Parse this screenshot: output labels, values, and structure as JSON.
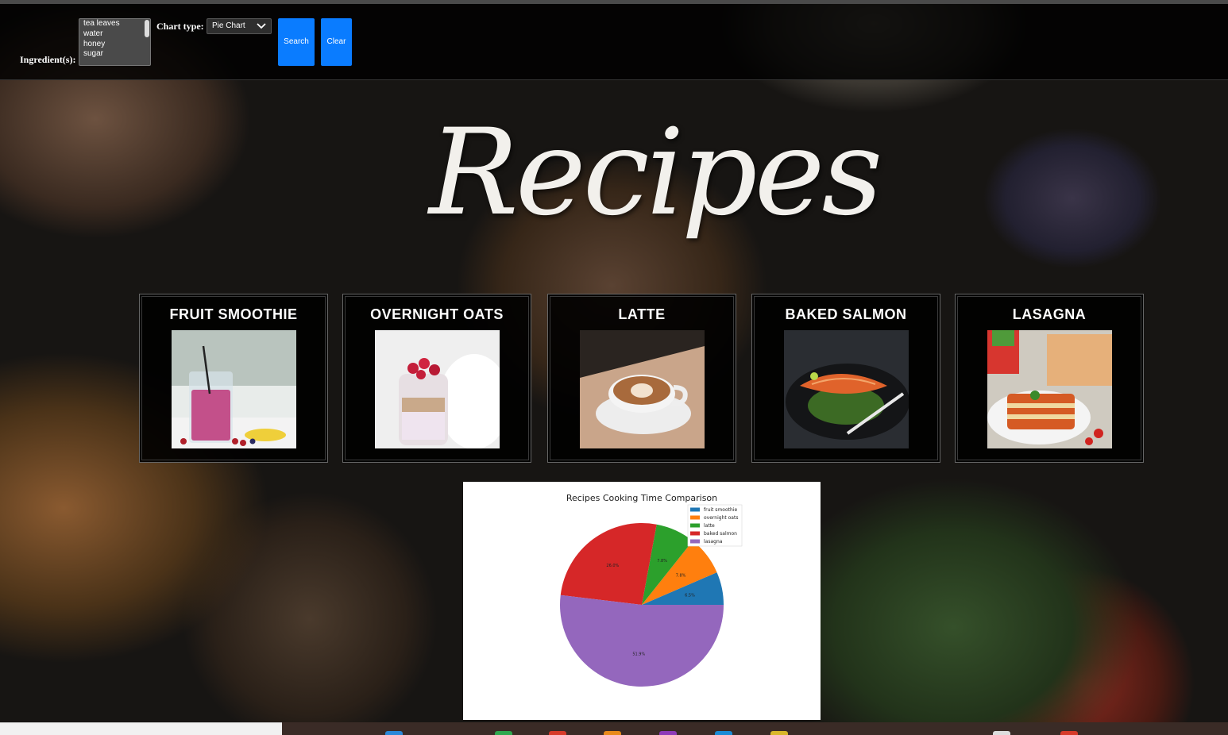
{
  "toolbar": {
    "ingredients_label": "Ingredient(s):",
    "ingredients": [
      "tea leaves",
      "water",
      "honey",
      "sugar"
    ],
    "chart_type_label": "Chart type:",
    "chart_type_value": "Pie Chart",
    "search_label": "Search",
    "clear_label": "Clear"
  },
  "page_title": "Recipes",
  "recipes": [
    {
      "name": "FRUIT SMOOTHIE",
      "image": "smoothie-photo"
    },
    {
      "name": "OVERNIGHT OATS",
      "image": "oats-photo"
    },
    {
      "name": "LATTE",
      "image": "latte-photo"
    },
    {
      "name": "BAKED SALMON",
      "image": "salmon-photo"
    },
    {
      "name": "LASAGNA",
      "image": "lasagna-photo"
    }
  ],
  "chart_data": {
    "type": "pie",
    "title": "Recipes Cooking Time Comparison",
    "categories": [
      "fruit smoothie",
      "overnight oats",
      "latte",
      "baked salmon",
      "lasagna"
    ],
    "values": [
      6.5,
      7.8,
      7.8,
      26.0,
      51.9
    ],
    "labels": [
      "6.5%",
      "7.8%",
      "7.8%",
      "26.0%",
      "51.9%"
    ],
    "colors": [
      "#1f77b4",
      "#ff7f0e",
      "#2ca02c",
      "#d62728",
      "#9467bd"
    ],
    "legend": "upper-right"
  },
  "colors": {
    "accent": "#0a7cff",
    "card_bg": "#000000"
  }
}
